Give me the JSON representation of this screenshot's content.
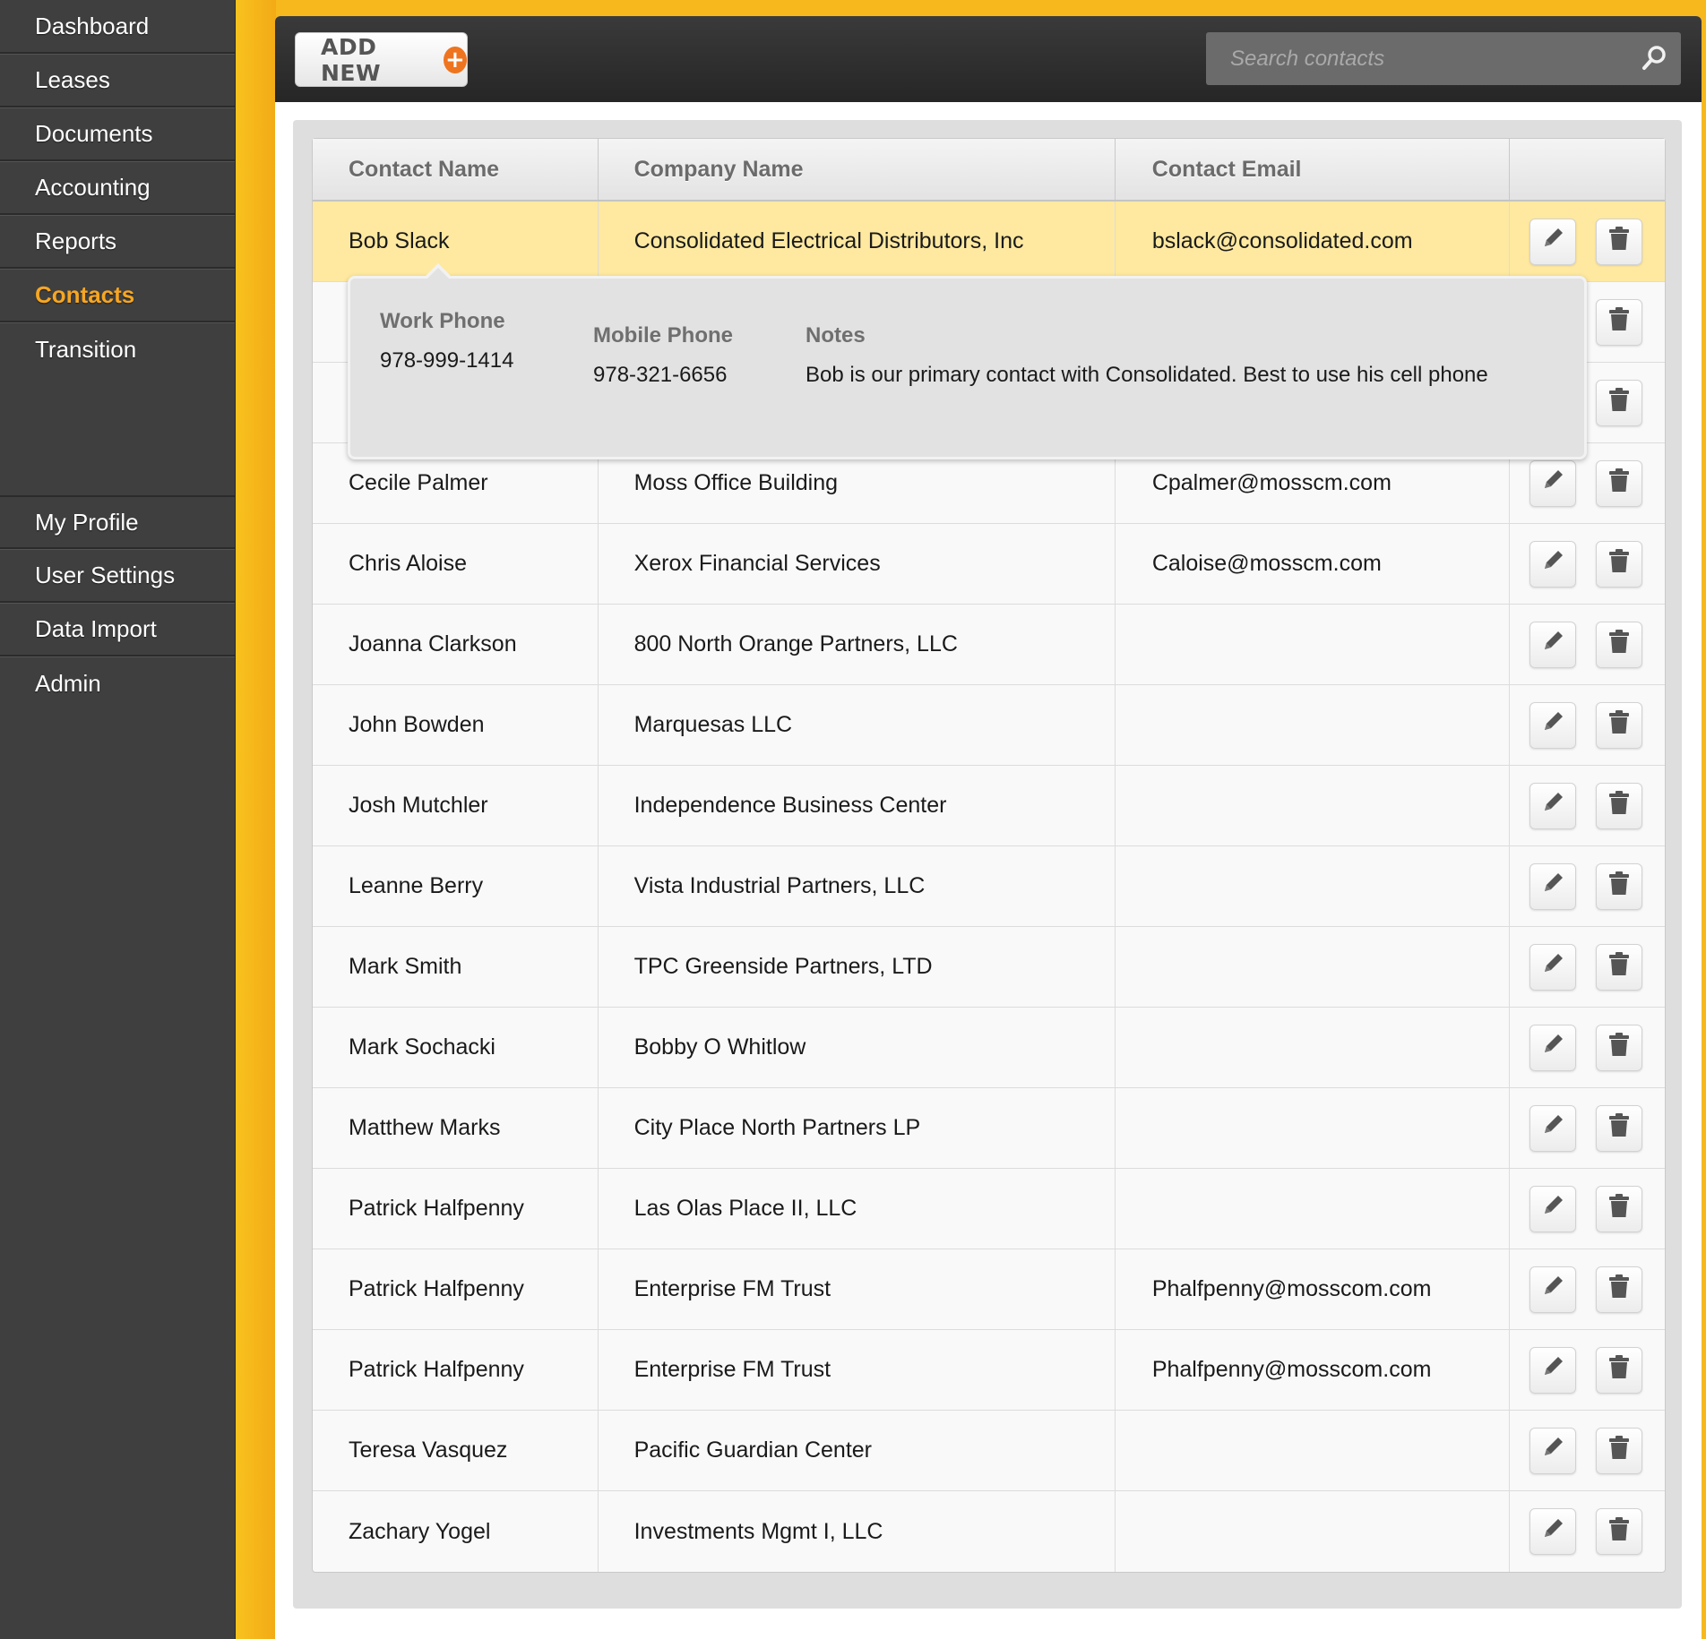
{
  "sidebar": {
    "top_items": [
      {
        "label": "Dashboard"
      },
      {
        "label": "Leases"
      },
      {
        "label": "Documents"
      },
      {
        "label": "Accounting"
      },
      {
        "label": "Reports"
      },
      {
        "label": "Contacts"
      },
      {
        "label": "Transition"
      }
    ],
    "active": "Contacts",
    "bottom_items": [
      {
        "label": "My Profile"
      },
      {
        "label": "User Settings"
      },
      {
        "label": "Data Import"
      },
      {
        "label": "Admin"
      }
    ]
  },
  "toolbar": {
    "add_new_label": "ADD NEW",
    "add_new_icon": "plus-circle-icon",
    "search_placeholder": "Search contacts",
    "search_icon": "magnifier-icon"
  },
  "table": {
    "columns": [
      "Contact Name",
      "Company Name",
      "Contact Email",
      ""
    ],
    "rows": [
      {
        "name": "Bob Slack",
        "company": "Consolidated Electrical Distributors, Inc",
        "email": "bslack@consolidated.com",
        "selected": true
      },
      {
        "name": "",
        "company": "",
        "email": ""
      },
      {
        "name": "",
        "company": "",
        "email": ""
      },
      {
        "name": "Cecile Palmer",
        "company": "Moss Office Building",
        "email": "Cpalmer@mosscm.com"
      },
      {
        "name": "Chris Aloise",
        "company": "Xerox Financial Services",
        "email": "Caloise@mosscm.com"
      },
      {
        "name": "Joanna Clarkson",
        "company": "800 North Orange Partners, LLC",
        "email": ""
      },
      {
        "name": "John Bowden",
        "company": "Marquesas LLC",
        "email": ""
      },
      {
        "name": "Josh Mutchler",
        "company": "Independence Business Center",
        "email": ""
      },
      {
        "name": "Leanne Berry",
        "company": "Vista Industrial Partners, LLC",
        "email": ""
      },
      {
        "name": "Mark Smith",
        "company": "TPC Greenside Partners, LTD",
        "email": ""
      },
      {
        "name": "Mark Sochacki",
        "company": "Bobby O Whitlow",
        "email": ""
      },
      {
        "name": "Matthew Marks",
        "company": "City Place North Partners LP",
        "email": ""
      },
      {
        "name": "Patrick Halfpenny",
        "company": "Las Olas Place II, LLC",
        "email": ""
      },
      {
        "name": "Patrick Halfpenny",
        "company": "Enterprise FM Trust",
        "email": "Phalfpenny@mosscom.com"
      },
      {
        "name": "Patrick Halfpenny",
        "company": "Enterprise FM Trust",
        "email": "Phalfpenny@mosscom.com"
      },
      {
        "name": "Teresa Vasquez",
        "company": "Pacific Guardian Center",
        "email": ""
      },
      {
        "name": "Zachary Yogel",
        "company": "Investments Mgmt I, LLC",
        "email": ""
      }
    ],
    "row_actions": {
      "edit_icon": "pencil-icon",
      "delete_icon": "trash-icon"
    }
  },
  "popover": {
    "work_phone_label": "Work Phone",
    "work_phone": "978-999-1414",
    "mobile_phone_label": "Mobile Phone",
    "mobile_phone": "978-321-6656",
    "notes_label": "Notes",
    "notes": "Bob is our primary contact with Consolidated. Best to use his cell phone"
  },
  "colors": {
    "accent_yellow": "#f6b81c",
    "active_nav": "#f6a623",
    "selected_row": "#ffe9a0",
    "add_icon": "#ef7420"
  }
}
